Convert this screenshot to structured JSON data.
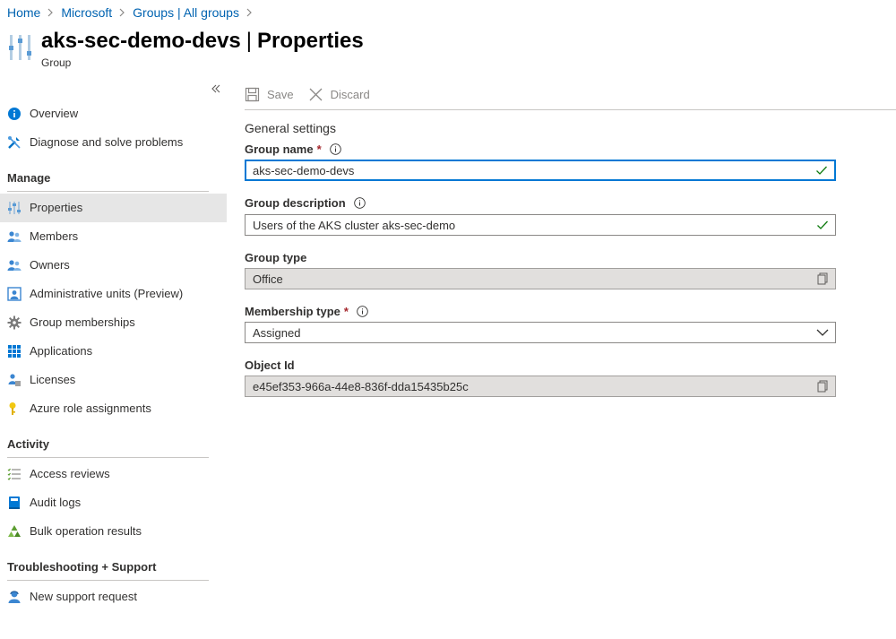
{
  "breadcrumb": [
    {
      "label": "Home"
    },
    {
      "label": "Microsoft"
    },
    {
      "label": "Groups | All groups"
    }
  ],
  "header": {
    "name": "aks-sec-demo-devs",
    "separator": "|",
    "page": "Properties",
    "subtitle": "Group"
  },
  "sidebar": {
    "items": [
      {
        "label": "Overview",
        "icon": "info-icon"
      },
      {
        "label": "Diagnose and solve problems",
        "icon": "wrench-icon"
      }
    ],
    "manage_header": "Manage",
    "manage_items": [
      {
        "label": "Properties",
        "icon": "properties-icon",
        "active": true
      },
      {
        "label": "Members",
        "icon": "people-icon"
      },
      {
        "label": "Owners",
        "icon": "people-icon"
      },
      {
        "label": "Administrative units (Preview)",
        "icon": "admin-units-icon"
      },
      {
        "label": "Group memberships",
        "icon": "gear-icon"
      },
      {
        "label": "Applications",
        "icon": "grid-icon"
      },
      {
        "label": "Licenses",
        "icon": "license-icon"
      },
      {
        "label": "Azure role assignments",
        "icon": "key-icon"
      }
    ],
    "activity_header": "Activity",
    "activity_items": [
      {
        "label": "Access reviews",
        "icon": "checklist-icon"
      },
      {
        "label": "Audit logs",
        "icon": "book-icon"
      },
      {
        "label": "Bulk operation results",
        "icon": "recycle-icon"
      }
    ],
    "support_header": "Troubleshooting + Support",
    "support_items": [
      {
        "label": "New support request",
        "icon": "support-person-icon"
      }
    ]
  },
  "toolbar": {
    "save_label": "Save",
    "discard_label": "Discard"
  },
  "form": {
    "section_title": "General settings",
    "group_name": {
      "label": "Group name",
      "required": "*",
      "value": "aks-sec-demo-devs"
    },
    "group_description": {
      "label": "Group description",
      "value": "Users of the AKS cluster aks-sec-demo"
    },
    "group_type": {
      "label": "Group type",
      "value": "Office"
    },
    "membership_type": {
      "label": "Membership type",
      "required": "*",
      "value": "Assigned"
    },
    "object_id": {
      "label": "Object Id",
      "value": "e45ef353-966a-44e8-836f-dda15435b25c"
    }
  },
  "colors": {
    "link": "#0063b1",
    "focus_border": "#0078d4",
    "valid_check": "#107c10",
    "required": "#a4262c",
    "active_nav": "#e6e6e6"
  }
}
